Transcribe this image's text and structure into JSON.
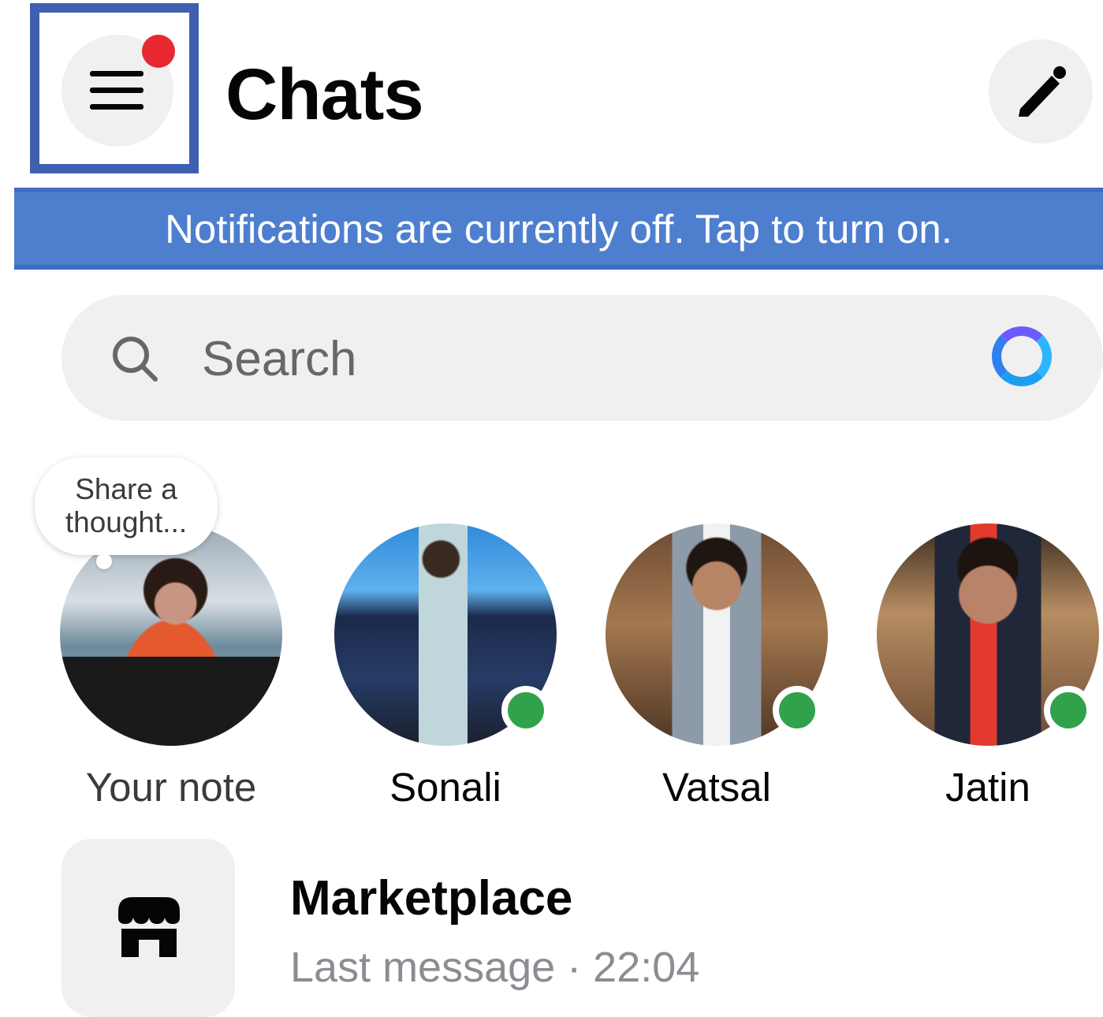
{
  "header": {
    "title": "Chats",
    "menu_icon": "hamburger-icon",
    "menu_has_badge": true,
    "badge_color": "#e8272f",
    "compose_icon": "pencil-icon"
  },
  "notification_banner": {
    "text": "Notifications are currently off. Tap to turn on.",
    "background": "#4e7fcf"
  },
  "search": {
    "placeholder": "Search",
    "icon": "search-icon",
    "ai_icon": "meta-ai-ring-icon"
  },
  "notes": {
    "prompt": "Share a thought..."
  },
  "stories": [
    {
      "name": "Your note",
      "online": false
    },
    {
      "name": "Sonali",
      "online": true
    },
    {
      "name": "Vatsal",
      "online": true
    },
    {
      "name": "Jatin",
      "online": true
    }
  ],
  "chats": [
    {
      "title": "Marketplace",
      "preview": "Last message · 22:04",
      "icon": "storefront-icon"
    }
  ],
  "colors": {
    "online": "#31a24c",
    "accent": "#3f5fb0"
  }
}
